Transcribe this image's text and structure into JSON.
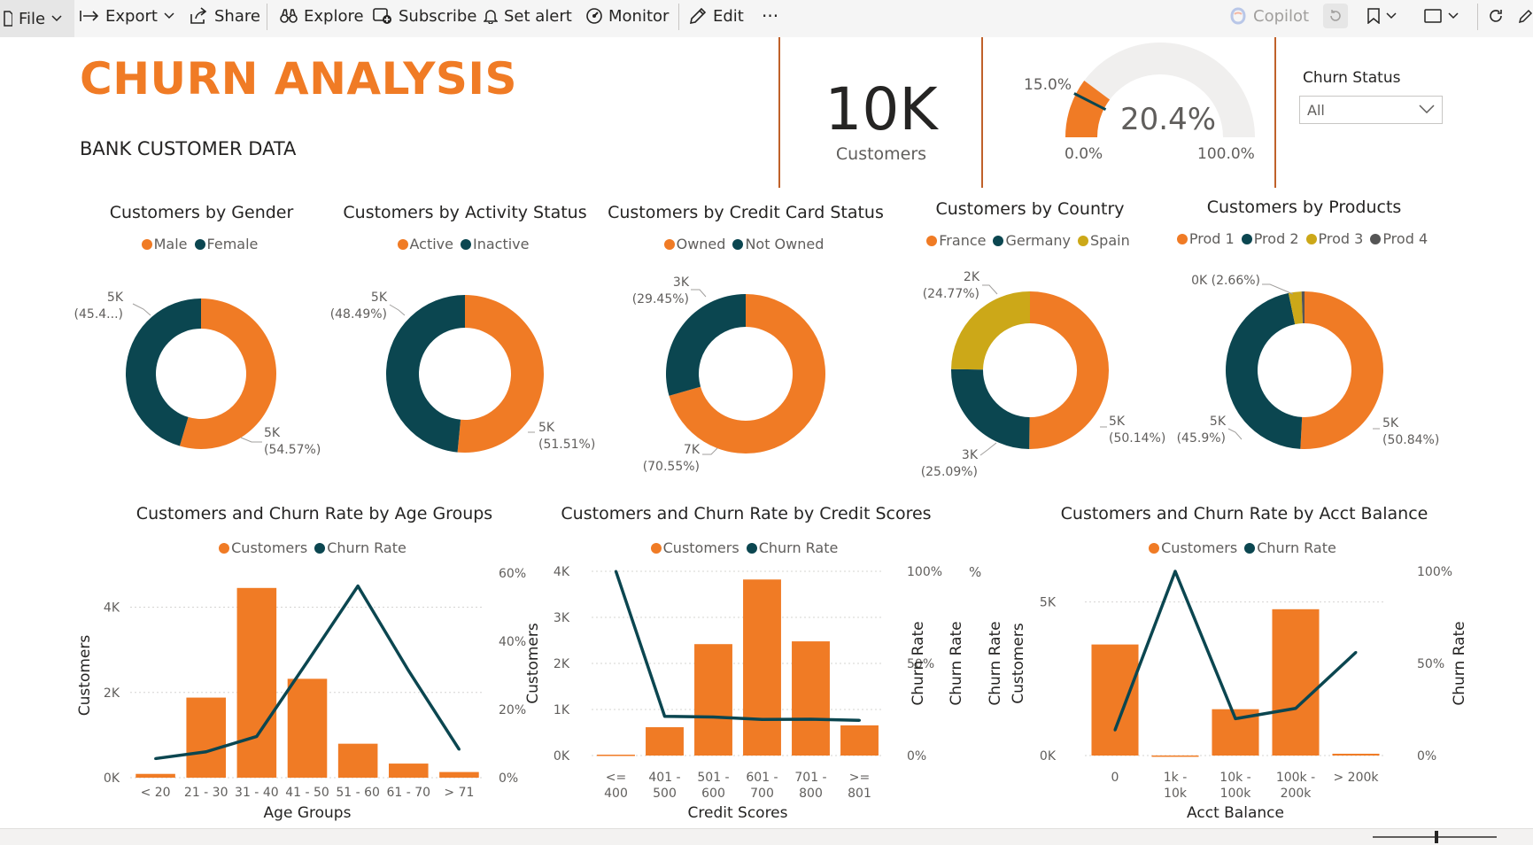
{
  "toolbar": {
    "file": "File",
    "export": "Export",
    "share": "Share",
    "explore": "Explore",
    "subscribe": "Subscribe",
    "set_alert": "Set alert",
    "monitor": "Monitor",
    "edit": "Edit",
    "more": "···",
    "copilot": "Copilot"
  },
  "header": {
    "title": "CHURN ANALYSIS",
    "subtitle": "BANK CUSTOMER DATA"
  },
  "kpi": {
    "value": "10K",
    "label": "Customers"
  },
  "gauge": {
    "value_label": "20.4%",
    "target_label": "15.0%",
    "min_label": "0.0%",
    "max_label": "100.0%",
    "value": 20.4,
    "target": 15.0,
    "min": 0,
    "max": 100
  },
  "slicer": {
    "title": "Churn Status",
    "value": "All"
  },
  "colors": {
    "orange": "#f07b25",
    "teal": "#0b4650",
    "gold": "#cca818",
    "gray": "#555555",
    "track": "#f0efee"
  },
  "donuts": [
    {
      "title": "Customers by Gender",
      "legend": [
        "Male",
        "Female"
      ],
      "slices": [
        {
          "name": "Male",
          "value": 54.57,
          "color": "#f07b25"
        },
        {
          "name": "Female",
          "value": 45.43,
          "color": "#0b4650"
        }
      ],
      "labels": [
        {
          "l1": "5K",
          "l2": "(54.57%)"
        },
        {
          "l1": "5K",
          "l2": "(45.4...)"
        }
      ]
    },
    {
      "title": "Customers by Activity Status",
      "legend": [
        "Active",
        "Inactive"
      ],
      "slices": [
        {
          "name": "Active",
          "value": 51.51,
          "color": "#f07b25"
        },
        {
          "name": "Inactive",
          "value": 48.49,
          "color": "#0b4650"
        }
      ],
      "labels": [
        {
          "l1": "5K",
          "l2": "(51.51%)"
        },
        {
          "l1": "5K",
          "l2": "(48.49%)"
        }
      ]
    },
    {
      "title": "Customers by Credit Card Status",
      "legend": [
        "Owned",
        "Not Owned"
      ],
      "slices": [
        {
          "name": "Owned",
          "value": 70.55,
          "color": "#f07b25"
        },
        {
          "name": "Not Owned",
          "value": 29.45,
          "color": "#0b4650"
        }
      ],
      "labels": [
        {
          "l1": "7K",
          "l2": "(70.55%)"
        },
        {
          "l1": "3K",
          "l2": "(29.45%)"
        }
      ]
    },
    {
      "title": "Customers by Country",
      "legend": [
        "France",
        "Germany",
        "Spain"
      ],
      "slices": [
        {
          "name": "France",
          "value": 50.14,
          "color": "#f07b25"
        },
        {
          "name": "Germany",
          "value": 25.09,
          "color": "#0b4650"
        },
        {
          "name": "Spain",
          "value": 24.77,
          "color": "#cca818"
        }
      ],
      "labels": [
        {
          "l1": "5K",
          "l2": "(50.14%)"
        },
        {
          "l1": "3K",
          "l2": "(25.09%)"
        },
        {
          "l1": "2K",
          "l2": "(24.77%)"
        }
      ]
    },
    {
      "title": "Customers by Products",
      "legend": [
        "Prod 1",
        "Prod 2",
        "Prod 3",
        "Prod 4"
      ],
      "slices": [
        {
          "name": "Prod 1",
          "value": 50.84,
          "color": "#f07b25"
        },
        {
          "name": "Prod 2",
          "value": 45.9,
          "color": "#0b4650"
        },
        {
          "name": "Prod 3",
          "value": 2.66,
          "color": "#cca818"
        },
        {
          "name": "Prod 4",
          "value": 0.6,
          "color": "#555555"
        }
      ],
      "labels": [
        {
          "l1": "5K",
          "l2": "(50.84%)"
        },
        {
          "l1": "5K",
          "l2": "(45.9%)"
        },
        {
          "l1": "0K (2.66%)",
          "l2": ""
        }
      ]
    }
  ],
  "chart_data": [
    {
      "type": "bar",
      "title": "Customers and Churn Rate by Age Groups",
      "legend": [
        "Customers",
        "Churn Rate"
      ],
      "categories": [
        "< 20",
        "21 - 30",
        "31 - 40",
        "41 - 50",
        "51 - 60",
        "61 - 70",
        "> 71"
      ],
      "series": [
        {
          "name": "Customers",
          "values": [
            89,
            1879,
            4451,
            2320,
            797,
            331,
            133
          ]
        },
        {
          "name": "Churn Rate",
          "values": [
            5.6,
            7.6,
            12.1,
            34.0,
            56.2,
            31.4,
            8.3
          ]
        }
      ],
      "xlabel": "Age Groups",
      "ylabel": "Customers",
      "y2label": "",
      "ylim": [
        0,
        4800
      ],
      "y2lim": [
        0,
        60
      ],
      "yticks": [
        "0K",
        "2K",
        "4K"
      ],
      "y2ticks": [
        "0%",
        "20%",
        "40%",
        "60%"
      ]
    },
    {
      "type": "bar",
      "title": "Customers and Churn Rate by Credit Scores",
      "legend": [
        "Customers",
        "Churn Rate"
      ],
      "categories": [
        "<= 400",
        "401 - 500",
        "501 - 600",
        "601 - 700",
        "701 - 800",
        ">= 801"
      ],
      "series": [
        {
          "name": "Customers",
          "values": [
            19,
            615,
            2419,
            3822,
            2479,
            655
          ]
        },
        {
          "name": "Churn Rate",
          "values": [
            100,
            21.3,
            20.9,
            19.6,
            19.7,
            19.1
          ]
        }
      ],
      "xlabel": "Credit Scores",
      "ylabel": "Customers",
      "y2label": "Churn Rate",
      "ylim": [
        0,
        4000
      ],
      "y2lim": [
        0,
        100
      ],
      "yticks": [
        "0K",
        "1K",
        "2K",
        "3K",
        "4K"
      ],
      "y2ticks": [
        "0%",
        "50%",
        "100%"
      ]
    },
    {
      "type": "bar",
      "title": "Customers and Churn Rate by Acct Balance",
      "legend": [
        "Customers",
        "Churn Rate"
      ],
      "categories": [
        "0",
        "1k - 10k",
        "10k - 100k",
        "100k - 200k",
        "> 200k"
      ],
      "series": [
        {
          "name": "Customers",
          "values": [
            3617,
            2,
            1509,
            4765,
            59
          ]
        },
        {
          "name": "Churn Rate",
          "values": [
            13.8,
            100,
            20.0,
            25.6,
            56.0
          ]
        }
      ],
      "xlabel": "Acct Balance",
      "ylabel": "Customers",
      "y2label": "Churn Rate",
      "ylim": [
        0,
        6000
      ],
      "y2lim": [
        0,
        100
      ],
      "yticks": [
        "0K",
        "5K"
      ],
      "y2ticks": [
        "0%",
        "50%",
        "100%"
      ]
    }
  ],
  "stray_axis_labels": {
    "pct": "%",
    "churn_rate": "Churn Rate",
    "customers": "Customers"
  }
}
